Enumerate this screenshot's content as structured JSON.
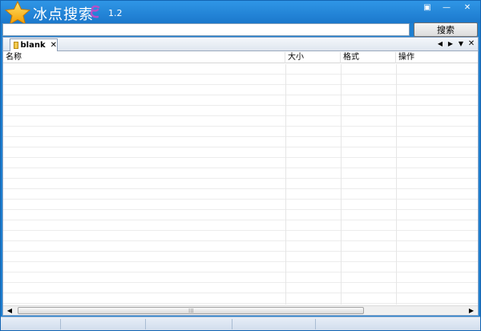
{
  "app": {
    "title": "冰点搜索",
    "version": "1.2",
    "brand_colors": {
      "titlebar": "#1e7fd0",
      "star": "#f7b500",
      "logo_e": "#b44fc8"
    }
  },
  "window_controls": [
    {
      "name": "restore",
      "icon": "restore-icon",
      "glyph": "▣"
    },
    {
      "name": "minimize",
      "icon": "minimize-icon",
      "glyph": "—"
    },
    {
      "name": "close",
      "icon": "close-icon",
      "glyph": "✕"
    }
  ],
  "search": {
    "value": "",
    "placeholder": "",
    "button_label": "搜索"
  },
  "tabs": [
    {
      "label": "blank",
      "icon": "folder-icon",
      "close_glyph": "✕",
      "active": true
    }
  ],
  "tab_tools": {
    "prev_glyph": "◀",
    "next_glyph": "▶",
    "menu_glyph": "▼",
    "close_glyph": "✕"
  },
  "table": {
    "columns": [
      "名称",
      "大小",
      "格式",
      "操作"
    ],
    "rows": []
  },
  "scrollbar": {
    "left_glyph": "◀",
    "right_glyph": "▶",
    "grip_glyph": "⁞⁞⁞"
  },
  "statusbar": {
    "segments": [
      "",
      "",
      "",
      "",
      ""
    ]
  }
}
